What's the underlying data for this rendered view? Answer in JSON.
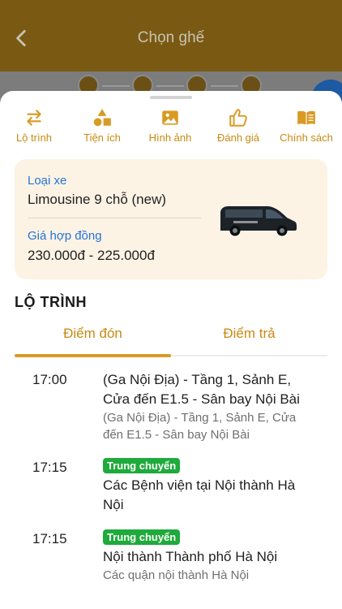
{
  "app_bar": {
    "title": "Chọn ghế",
    "back_icon": "back-arrow-icon"
  },
  "steps": [
    {
      "icon": "seat-icon"
    },
    {
      "icon": "transfer-icon"
    },
    {
      "icon": "user-icon"
    },
    {
      "icon": "payment-card-icon"
    }
  ],
  "tabs": [
    {
      "label": "Lộ trình",
      "icon": "route-arrows-icon"
    },
    {
      "label": "Tiện ích",
      "icon": "amenities-shapes-icon"
    },
    {
      "label": "Hình ảnh",
      "icon": "image-icon"
    },
    {
      "label": "Đánh giá",
      "icon": "thumbs-up-icon"
    },
    {
      "label": "Chính sách",
      "icon": "book-icon"
    }
  ],
  "vehicle": {
    "type_label": "Loại xe",
    "type_value": "Limousine 9 chỗ (new)",
    "price_label": "Giá hợp đồng",
    "price_value": "230.000đ - 225.000đ"
  },
  "route": {
    "title": "LỘ TRÌNH",
    "tabs": [
      {
        "label": "Điểm đón"
      },
      {
        "label": "Điểm trả"
      }
    ],
    "stops": [
      {
        "time": "17:00",
        "badge": "",
        "main": "(Ga Nội Địa) - Tầng 1, Sảnh E, Cửa đến E1.5  - Sân bay Nội Bài",
        "sub": "(Ga Nội Địa) - Tầng 1, Sảnh E, Cửa đến E1.5  - Sân bay Nội Bài"
      },
      {
        "time": "17:15",
        "badge": "Trung chuyển",
        "main": "Các Bệnh viện tại Nội thành Hà Nội",
        "sub": ""
      },
      {
        "time": "17:15",
        "badge": "Trung chuyển",
        "main": "Nội thành Thành phố Hà Nội",
        "sub": "Các quận nội thành Hà Nội"
      }
    ]
  },
  "colors": {
    "accent": "#c88a12",
    "link": "#2474d8",
    "badge": "#1faa3c",
    "card_bg": "#fcf3e5"
  }
}
